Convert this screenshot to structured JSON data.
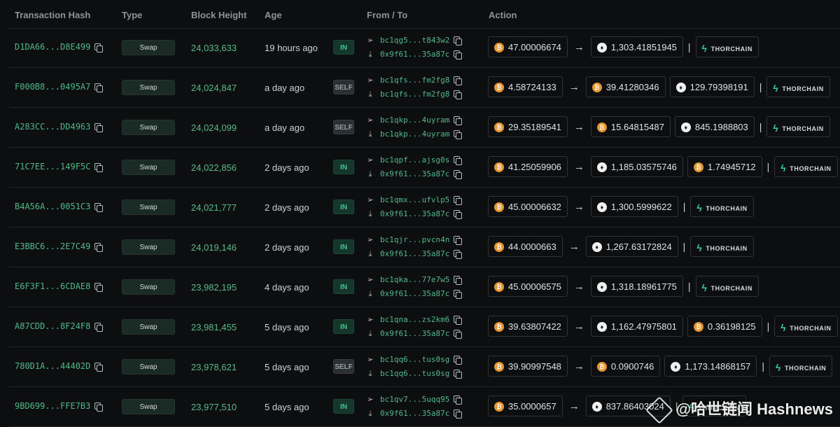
{
  "header": {
    "hash": "Transaction Hash",
    "type": "Type",
    "block": "Block Height",
    "age": "Age",
    "fromto": "From / To",
    "action": "Action"
  },
  "rows": [
    {
      "hash": "D1DA66...D8E499",
      "type": "Swap",
      "block": "24,033,633",
      "age": "19 hours ago",
      "dir": "IN",
      "from": "bc1qg5...t843w2",
      "to": "0x9f61...35a87c",
      "action": [
        {
          "k": "pill",
          "coin": "btc",
          "v": "47.00006674"
        },
        {
          "k": "arrow"
        },
        {
          "k": "pill",
          "coin": "eth",
          "v": "1,303.41851945"
        }
      ],
      "thor": "THORCHAIN"
    },
    {
      "hash": "F000B8...0495A7",
      "type": "Swap",
      "block": "24,024,847",
      "age": "a day ago",
      "dir": "SELF",
      "from": "bc1qfs...fm2fg8",
      "to": "bc1qfs...fm2fg8",
      "action": [
        {
          "k": "pill",
          "coin": "btc",
          "v": "4.58724133"
        },
        {
          "k": "arrow"
        },
        {
          "k": "pill",
          "coin": "btc",
          "v": "39.41280346"
        },
        {
          "k": "pill",
          "coin": "eth",
          "v": "129.79398191"
        }
      ],
      "thor": "THORCHAIN"
    },
    {
      "hash": "A283CC...DD4963",
      "type": "Swap",
      "block": "24,024,099",
      "age": "a day ago",
      "dir": "SELF",
      "from": "bc1qkp...4uyram",
      "to": "bc1qkp...4uyram",
      "action": [
        {
          "k": "pill",
          "coin": "btc",
          "v": "29.35189541"
        },
        {
          "k": "arrow"
        },
        {
          "k": "pill",
          "coin": "btc",
          "v": "15.64815487"
        },
        {
          "k": "pill",
          "coin": "eth",
          "v": "845.1988803"
        }
      ],
      "thor": "THORCHAIN"
    },
    {
      "hash": "71C7EE...149F5C",
      "type": "Swap",
      "block": "24,022,856",
      "age": "2 days ago",
      "dir": "IN",
      "from": "bc1qpf...ajsg0s",
      "to": "0x9f61...35a87c",
      "action": [
        {
          "k": "pill",
          "coin": "btc",
          "v": "41.25059906"
        },
        {
          "k": "arrow"
        },
        {
          "k": "pill",
          "coin": "eth",
          "v": "1,185.03575746"
        },
        {
          "k": "pill",
          "coin": "btc",
          "v": "1.74945712"
        }
      ],
      "thor": "THORCHAIN"
    },
    {
      "hash": "B4A56A...0051C3",
      "type": "Swap",
      "block": "24,021,777",
      "age": "2 days ago",
      "dir": "IN",
      "from": "bc1qmx...ufvlp5",
      "to": "0x9f61...35a87c",
      "action": [
        {
          "k": "pill",
          "coin": "btc",
          "v": "45.00006632"
        },
        {
          "k": "arrow"
        },
        {
          "k": "pill",
          "coin": "eth",
          "v": "1,300.5999622"
        }
      ],
      "thor": "THORCHAIN"
    },
    {
      "hash": "E3BBC6...2E7C49",
      "type": "Swap",
      "block": "24,019,146",
      "age": "2 days ago",
      "dir": "IN",
      "from": "bc1qjr...pvcn4n",
      "to": "0x9f61...35a87c",
      "action": [
        {
          "k": "pill",
          "coin": "btc",
          "v": "44.0000663"
        },
        {
          "k": "arrow"
        },
        {
          "k": "pill",
          "coin": "eth",
          "v": "1,267.63172824"
        }
      ],
      "thor": "THORCHAIN"
    },
    {
      "hash": "E6F3F1...6CDAE8",
      "type": "Swap",
      "block": "23,982,195",
      "age": "4 days ago",
      "dir": "IN",
      "from": "bc1qka...77e7w5",
      "to": "0x9f61...35a87c",
      "action": [
        {
          "k": "pill",
          "coin": "btc",
          "v": "45.00006575"
        },
        {
          "k": "arrow"
        },
        {
          "k": "pill",
          "coin": "eth",
          "v": "1,318.18961775"
        }
      ],
      "thor": "THORCHAIN"
    },
    {
      "hash": "A87CDD...8F24F8",
      "type": "Swap",
      "block": "23,981,455",
      "age": "5 days ago",
      "dir": "IN",
      "from": "bc1qna...zs2km6",
      "to": "0x9f61...35a87c",
      "action": [
        {
          "k": "pill",
          "coin": "btc",
          "v": "39.63807422"
        },
        {
          "k": "arrow"
        },
        {
          "k": "pill",
          "coin": "eth",
          "v": "1,162.47975801"
        },
        {
          "k": "pill",
          "coin": "btc",
          "v": "0.36198125"
        }
      ],
      "thor": "THORCHAIN"
    },
    {
      "hash": "780D1A...44402D",
      "type": "Swap",
      "block": "23,978,621",
      "age": "5 days ago",
      "dir": "SELF",
      "from": "bc1qq6...tus0sg",
      "to": "bc1qq6...tus0sg",
      "action": [
        {
          "k": "pill",
          "coin": "btc",
          "v": "39.90997548"
        },
        {
          "k": "arrow"
        },
        {
          "k": "pill",
          "coin": "btc",
          "v": "0.0900746"
        },
        {
          "k": "pill",
          "coin": "eth",
          "v": "1,173.14868157"
        }
      ],
      "thor": "THORCHAIN"
    },
    {
      "hash": "9BD699...FFE7B3",
      "type": "Swap",
      "block": "23,977,510",
      "age": "5 days ago",
      "dir": "IN",
      "from": "bc1qv7...5uqq95",
      "to": "0x9f61...35a87c",
      "action": [
        {
          "k": "pill",
          "coin": "btc",
          "v": "35.0000657"
        },
        {
          "k": "arrow"
        },
        {
          "k": "pill",
          "coin": "eth",
          "v": "837.86403024"
        }
      ],
      "thor": "THORCHAIN"
    }
  ],
  "watermark": "@哈世链闻 Hashnews",
  "colors": {
    "accent": "#4fb98a",
    "btc": "#e8962f",
    "thorchain": "#2fd1a7",
    "in_badge": "#15372b",
    "self_badge": "#2a2f32"
  },
  "icons": {
    "copy": "copy-icon",
    "send": "send-icon",
    "receive": "download-icon",
    "btc": "bitcoin-icon",
    "eth": "ethereum-icon",
    "thorchain": "thorchain-icon"
  }
}
